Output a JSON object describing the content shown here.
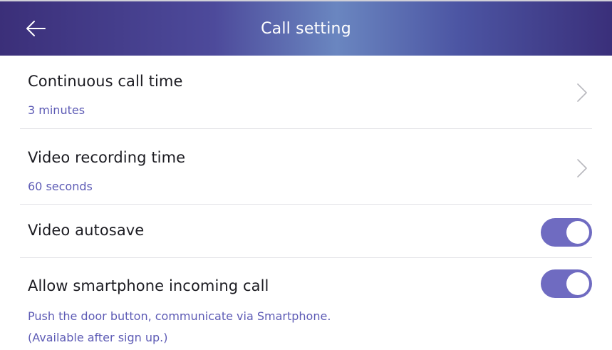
{
  "header": {
    "title": "Call setting",
    "back_icon": "arrow-left-icon"
  },
  "settings": [
    {
      "label": "Continuous call time",
      "value": "3 minutes",
      "control": "chevron-right-icon"
    },
    {
      "label": "Video recording time",
      "value": "60 seconds",
      "control": "chevron-right-icon"
    },
    {
      "label": "Video autosave",
      "control": "toggle",
      "enabled": true
    },
    {
      "label": "Allow smartphone incoming call",
      "description_line1": "Push the door button, communicate via Smartphone.",
      "description_line2": "(Available after sign up.)",
      "control": "toggle",
      "enabled": true
    }
  ],
  "colors": {
    "accent": "#6f6bc1",
    "subtext": "#5d5bb5",
    "header_start": "#3b2f79",
    "header_mid": "#6a86c0"
  }
}
